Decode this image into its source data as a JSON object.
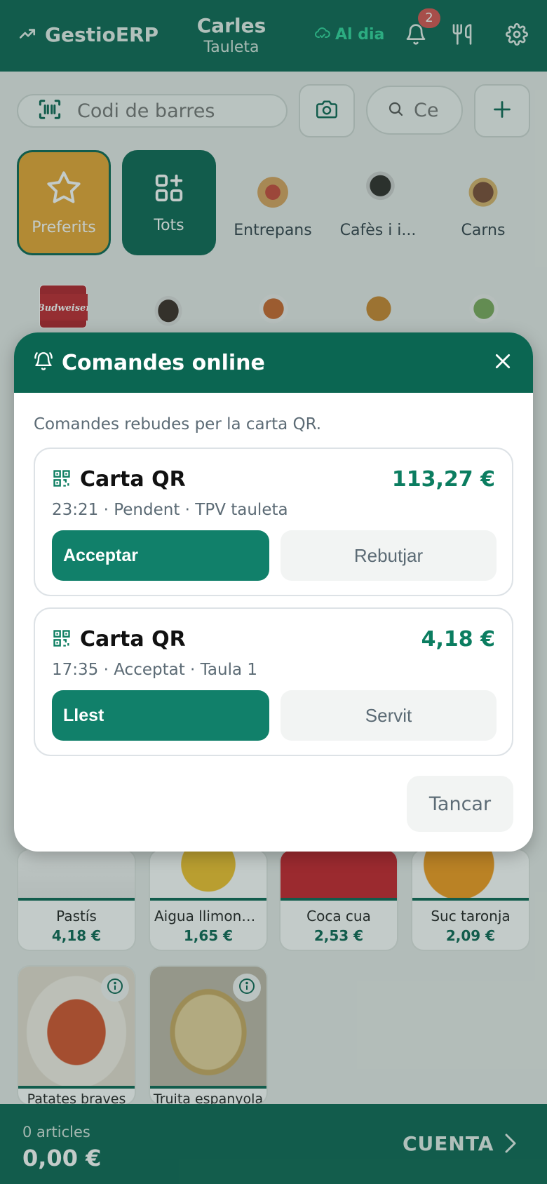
{
  "header": {
    "brand": "GestioERP",
    "user_name": "Carles",
    "device": "Tauleta",
    "sync_status": "Al dia",
    "notifications_count": "2",
    "colors": {
      "primary": "#0b6652",
      "accent": "#2fd49c",
      "badge": "#d9534f"
    }
  },
  "toolbar": {
    "barcode_placeholder": "Codi de barres",
    "search_placeholder": "Ce"
  },
  "categories": [
    {
      "label": "Preferits",
      "icon": "star-icon"
    },
    {
      "label": "Tots",
      "icon": "grid-plus-icon"
    },
    {
      "label": "Entrepans"
    },
    {
      "label": "Cafès i i..."
    },
    {
      "label": "Carns"
    }
  ],
  "products": [
    {
      "name": "Pastís",
      "price": "4,18 €"
    },
    {
      "name": "Aigua llimona ...",
      "price": "1,65 €"
    },
    {
      "name": "Coca cua",
      "price": "2,53 €"
    },
    {
      "name": "Suc taronja",
      "price": "2,09 €"
    },
    {
      "name": "Patates braves"
    },
    {
      "name": "Truita espanyola"
    }
  ],
  "footer": {
    "count": "0 articles",
    "total": "0,00 €",
    "checkout_label": "CUENTA"
  },
  "modal": {
    "title": "Comandes online",
    "subtitle": "Comandes rebudes per la carta QR.",
    "orders": [
      {
        "title": "Carta QR",
        "amount": "113,27 €",
        "meta": "23:21 · Pendent · TPV tauleta",
        "primary": "Acceptar",
        "secondary": "Rebutjar"
      },
      {
        "title": "Carta QR",
        "amount": "4,18 €",
        "meta": "17:35 · Acceptat · Taula 1",
        "primary": "Llest",
        "secondary": "Servit"
      }
    ],
    "close_label": "Tancar"
  }
}
